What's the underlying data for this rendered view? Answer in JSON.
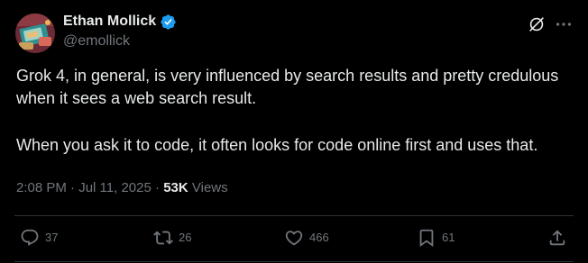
{
  "author": {
    "display_name": "Ethan Mollick",
    "handle": "@emollick",
    "verified_icon": "verified-badge-icon",
    "verified_color": "#1d9bf0"
  },
  "tweet": {
    "paragraph_1": "Grok 4, in general, is very influenced by search results and pretty credulous when it sees a web search result.",
    "paragraph_2": "When you ask it to code, it often looks for code online first and uses that."
  },
  "meta": {
    "time": "2:08 PM",
    "separator_1": "·",
    "date": "Jul 11, 2025",
    "separator_2": "·",
    "views_count": "53K",
    "views_label": "Views"
  },
  "actions": {
    "reply": {
      "icon": "reply-icon",
      "count": "37"
    },
    "repost": {
      "icon": "repost-icon",
      "count": "26"
    },
    "like": {
      "icon": "like-icon",
      "count": "466"
    },
    "bookmark": {
      "icon": "bookmark-icon",
      "count": "61"
    },
    "share": {
      "icon": "share-icon"
    }
  },
  "colors": {
    "background": "#000000",
    "primary_text": "#e7e9ea",
    "secondary_text": "#71767b",
    "divider": "#2f3336"
  }
}
